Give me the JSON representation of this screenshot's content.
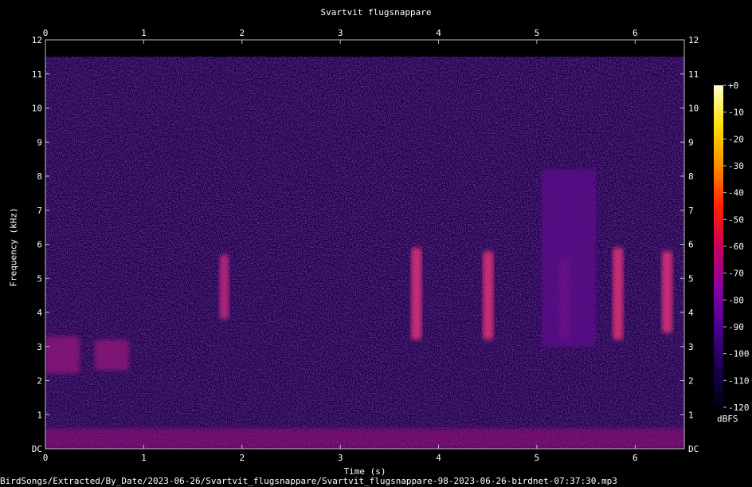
{
  "chart_data": {
    "type": "heatmap",
    "title": "Svartvit flugsnappare",
    "xlabel": "Time (s)",
    "ylabel": "Frequency (kHz)",
    "xlim": [
      0,
      6.5
    ],
    "ylim": [
      0,
      12
    ],
    "x_ticks": [
      "0",
      "1",
      "2",
      "3",
      "4",
      "5",
      "6"
    ],
    "y_ticks": [
      "DC",
      "1",
      "2",
      "3",
      "4",
      "5",
      "6",
      "7",
      "8",
      "9",
      "10",
      "11",
      "12"
    ],
    "colorbar": {
      "label": "dBFS",
      "ticks": [
        "+0",
        "-10",
        "-20",
        "-30",
        "-40",
        "-50",
        "-60",
        "-70",
        "-80",
        "-90",
        "-100",
        "-110",
        "-120"
      ],
      "range": [
        -120,
        0
      ],
      "colors": [
        "#000010",
        "#1a0050",
        "#4a0090",
        "#8a00a0",
        "#c8005a",
        "#ff2000",
        "#ff8c00",
        "#ffe000",
        "#ffffd0"
      ]
    },
    "noise_ceiling_khz": 11.5,
    "calls": [
      {
        "t_start": 1.77,
        "t_end": 1.87,
        "f_low": 3.8,
        "f_high": 5.7,
        "level_dbfs": -68
      },
      {
        "t_start": 3.72,
        "t_end": 3.83,
        "f_low": 3.2,
        "f_high": 5.9,
        "level_dbfs": -65
      },
      {
        "t_start": 4.45,
        "t_end": 4.56,
        "f_low": 3.2,
        "f_high": 5.8,
        "level_dbfs": -64
      },
      {
        "t_start": 5.23,
        "t_end": 5.34,
        "f_low": 3.2,
        "f_high": 5.6,
        "level_dbfs": -70
      },
      {
        "t_start": 5.77,
        "t_end": 5.88,
        "f_low": 3.2,
        "f_high": 5.9,
        "level_dbfs": -66
      },
      {
        "t_start": 6.27,
        "t_end": 6.38,
        "f_low": 3.4,
        "f_high": 5.8,
        "level_dbfs": -67
      },
      {
        "t_start": 0.5,
        "t_end": 0.85,
        "f_low": 2.3,
        "f_high": 3.2,
        "level_dbfs": -80
      },
      {
        "t_start": 0.0,
        "t_end": 0.35,
        "f_low": 2.2,
        "f_high": 3.3,
        "level_dbfs": -84
      },
      {
        "t_start": 5.05,
        "t_end": 5.6,
        "f_low": 3.0,
        "f_high": 8.2,
        "level_dbfs": -88
      }
    ]
  },
  "footer": "BirdSongs/Extracted/By_Date/2023-06-26/Svartvit_flugsnappare/Svartvit_flugsnappare-98-2023-06-26-birdnet-07:37:30.mp3"
}
